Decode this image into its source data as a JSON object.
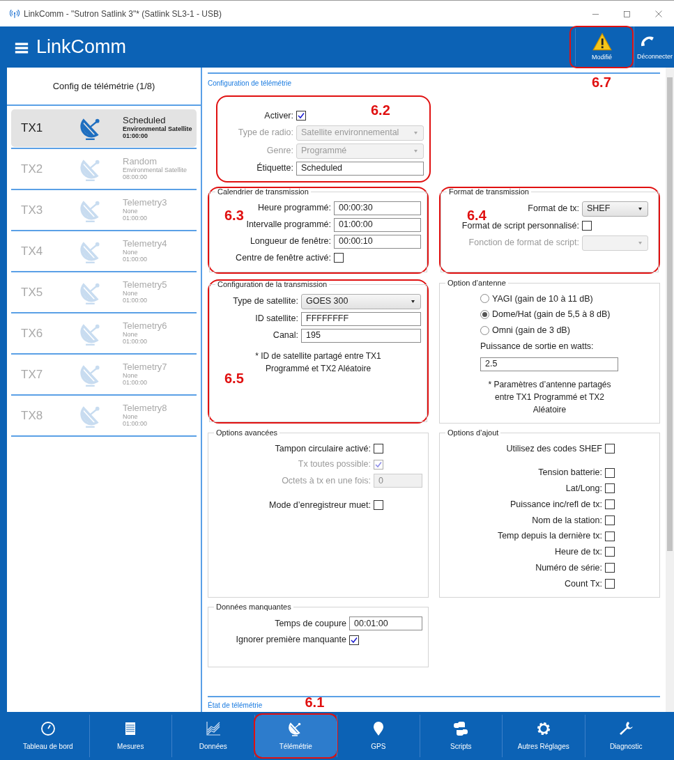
{
  "window": {
    "title": "LinkComm - \"Sutron Satlink 3\"* (Satlink SL3-1 - USB)"
  },
  "header": {
    "app_name": "LinkComm",
    "actions": [
      {
        "kind": "warning",
        "label": "Modifié",
        "callout": "6.7"
      },
      {
        "kind": "phone",
        "label": "Déconnecter"
      }
    ]
  },
  "sidebar": {
    "title": "Config de télémétrie (1/8)",
    "items": [
      {
        "tx": "TX1",
        "name": "Scheduled",
        "type": "Environmental Satellite",
        "interval": "01:00:00",
        "selected": true
      },
      {
        "tx": "TX2",
        "name": "Random",
        "type": "Environmental Satellite",
        "interval": "08:00:00",
        "selected": false
      },
      {
        "tx": "TX3",
        "name": "Telemetry3",
        "type": "None",
        "interval": "01:00:00",
        "selected": false
      },
      {
        "tx": "TX4",
        "name": "Telemetry4",
        "type": "None",
        "interval": "01:00:00",
        "selected": false
      },
      {
        "tx": "TX5",
        "name": "Telemetry5",
        "type": "None",
        "interval": "01:00:00",
        "selected": false
      },
      {
        "tx": "TX6",
        "name": "Telemetry6",
        "type": "None",
        "interval": "01:00:00",
        "selected": false
      },
      {
        "tx": "TX7",
        "name": "Telemetry7",
        "type": "None",
        "interval": "01:00:00",
        "selected": false
      },
      {
        "tx": "TX8",
        "name": "Telemetry8",
        "type": "None",
        "interval": "01:00:00",
        "selected": false
      }
    ]
  },
  "main": {
    "heading": "Configuration de télémétrie",
    "general": {
      "callout": "6.2",
      "fields": [
        {
          "kind": "checkbox",
          "label": "Activer:",
          "checked": true,
          "disabled": false
        },
        {
          "kind": "select",
          "label": "Type de radio:",
          "value": "Satellite environnemental",
          "disabled": true
        },
        {
          "kind": "select",
          "label": "Genre:",
          "value": "Programmé",
          "disabled": true
        },
        {
          "kind": "text",
          "label": "Étiquette:",
          "value": "Scheduled",
          "disabled": false
        }
      ]
    },
    "groups": [
      {
        "title": "Calendrier de transmission",
        "callout": "6.3",
        "fields": [
          {
            "kind": "text",
            "label": "Heure programmé:",
            "value": "00:00:30",
            "disabled": false
          },
          {
            "kind": "text",
            "label": "Intervalle programmé:",
            "value": "01:00:00",
            "disabled": false
          },
          {
            "kind": "text",
            "label": "Longueur de fenêtre:",
            "value": "00:00:10",
            "disabled": false
          },
          {
            "kind": "checkbox",
            "label": "Centre de fenêtre activé:",
            "checked": false,
            "disabled": false
          }
        ]
      },
      {
        "title": "Format de transmission",
        "callout": "6.4",
        "fields": [
          {
            "kind": "select",
            "label": "Format de tx:",
            "value": "SHEF",
            "disabled": false
          },
          {
            "kind": "checkbox",
            "label": "Format de script personnalisé:",
            "checked": false,
            "disabled": false
          },
          {
            "kind": "select",
            "label": "Fonction de format de script:",
            "disabled": true
          }
        ]
      },
      {
        "title": "Configuration de la transmission",
        "callout": "6.5",
        "fields": [
          {
            "kind": "select",
            "label": "Type de satellite:",
            "value": "GOES 300",
            "disabled": false
          },
          {
            "kind": "text",
            "label": "ID satellite:",
            "value": "FFFFFFFF",
            "disabled": false
          },
          {
            "kind": "text",
            "label": "Canal:",
            "value": "195",
            "disabled": false
          },
          {
            "kind": "note",
            "text": "* ID de satellite partagé entre TX1 Programmé et TX2 Aléatoire"
          }
        ]
      },
      {
        "title": "Option d’antenne",
        "fields": [
          {
            "kind": "radio",
            "label": "YAGI (gain de 10 à 11 dB)",
            "selected": false
          },
          {
            "kind": "radio",
            "label": "Dome/Hat (gain de 5,5 à 8 dB)",
            "selected": true
          },
          {
            "kind": "radio",
            "label": "Omni (gain de 3 dB)",
            "selected": false
          },
          {
            "kind": "stacked",
            "label": "Puissance de sortie en watts:",
            "value": "2.5"
          },
          {
            "kind": "note",
            "text": "* Paramètres d’antenne partagés entre TX1 Programmé et TX2 Aléatoire"
          }
        ]
      },
      {
        "title": "Options avancées",
        "fields": [
          {
            "kind": "checkbox",
            "label": "Tampon circulaire activé:",
            "checked": false,
            "disabled": false
          },
          {
            "kind": "checkbox",
            "label": "Tx toutes possible:",
            "checked": true,
            "disabled": true
          },
          {
            "kind": "text",
            "label": "Octets à tx en une fois:",
            "value": "0",
            "disabled": true
          },
          {
            "kind": "checkbox",
            "label": "Mode d’enregistreur muet:",
            "checked": false,
            "disabled": false
          }
        ]
      },
      {
        "title": "Options d’ajout",
        "fields": [
          {
            "kind": "checkbox",
            "label": "Utilisez des codes SHEF",
            "checked": false,
            "disabled": false
          },
          {
            "kind": "checkbox",
            "label": "Tension batterie:",
            "checked": false,
            "disabled": false
          },
          {
            "kind": "checkbox",
            "label": "Lat/Long:",
            "checked": false,
            "disabled": false
          },
          {
            "kind": "checkbox",
            "label": "Puissance inc/refl de tx:",
            "checked": false,
            "disabled": false
          },
          {
            "kind": "checkbox",
            "label": "Nom de la station:",
            "checked": false,
            "disabled": false
          },
          {
            "kind": "checkbox",
            "label": "Temp depuis la dernière tx:",
            "checked": false,
            "disabled": false
          },
          {
            "kind": "checkbox",
            "label": "Heure de tx:",
            "checked": false,
            "disabled": false
          },
          {
            "kind": "checkbox",
            "label": "Numéro de série:",
            "checked": false,
            "disabled": false
          },
          {
            "kind": "checkbox",
            "label": "Count Tx:",
            "checked": false,
            "disabled": false
          }
        ]
      },
      {
        "title": "Données manquantes",
        "fields": [
          {
            "kind": "text",
            "label": "Temps de coupure",
            "value": "00:01:00",
            "disabled": false
          },
          {
            "kind": "checkbox",
            "label": "Ignorer première manquante",
            "checked": true,
            "disabled": false
          }
        ]
      }
    ],
    "footer_heading": "État de télémétrie"
  },
  "bottom_nav": [
    {
      "kind": "gauge",
      "label": "Tableau de bord",
      "selected": false
    },
    {
      "kind": "list",
      "label": "Mesures",
      "selected": false
    },
    {
      "kind": "chart",
      "label": "Données",
      "selected": false
    },
    {
      "kind": "dish",
      "label": "Télémétrie",
      "selected": true,
      "callout": "6.1"
    },
    {
      "kind": "pin",
      "label": "GPS",
      "selected": false
    },
    {
      "kind": "blocks",
      "label": "Scripts",
      "selected": false
    },
    {
      "kind": "gear",
      "label": "Autres Réglages",
      "selected": false
    },
    {
      "kind": "wrench",
      "label": "Diagnostic",
      "selected": false
    }
  ]
}
